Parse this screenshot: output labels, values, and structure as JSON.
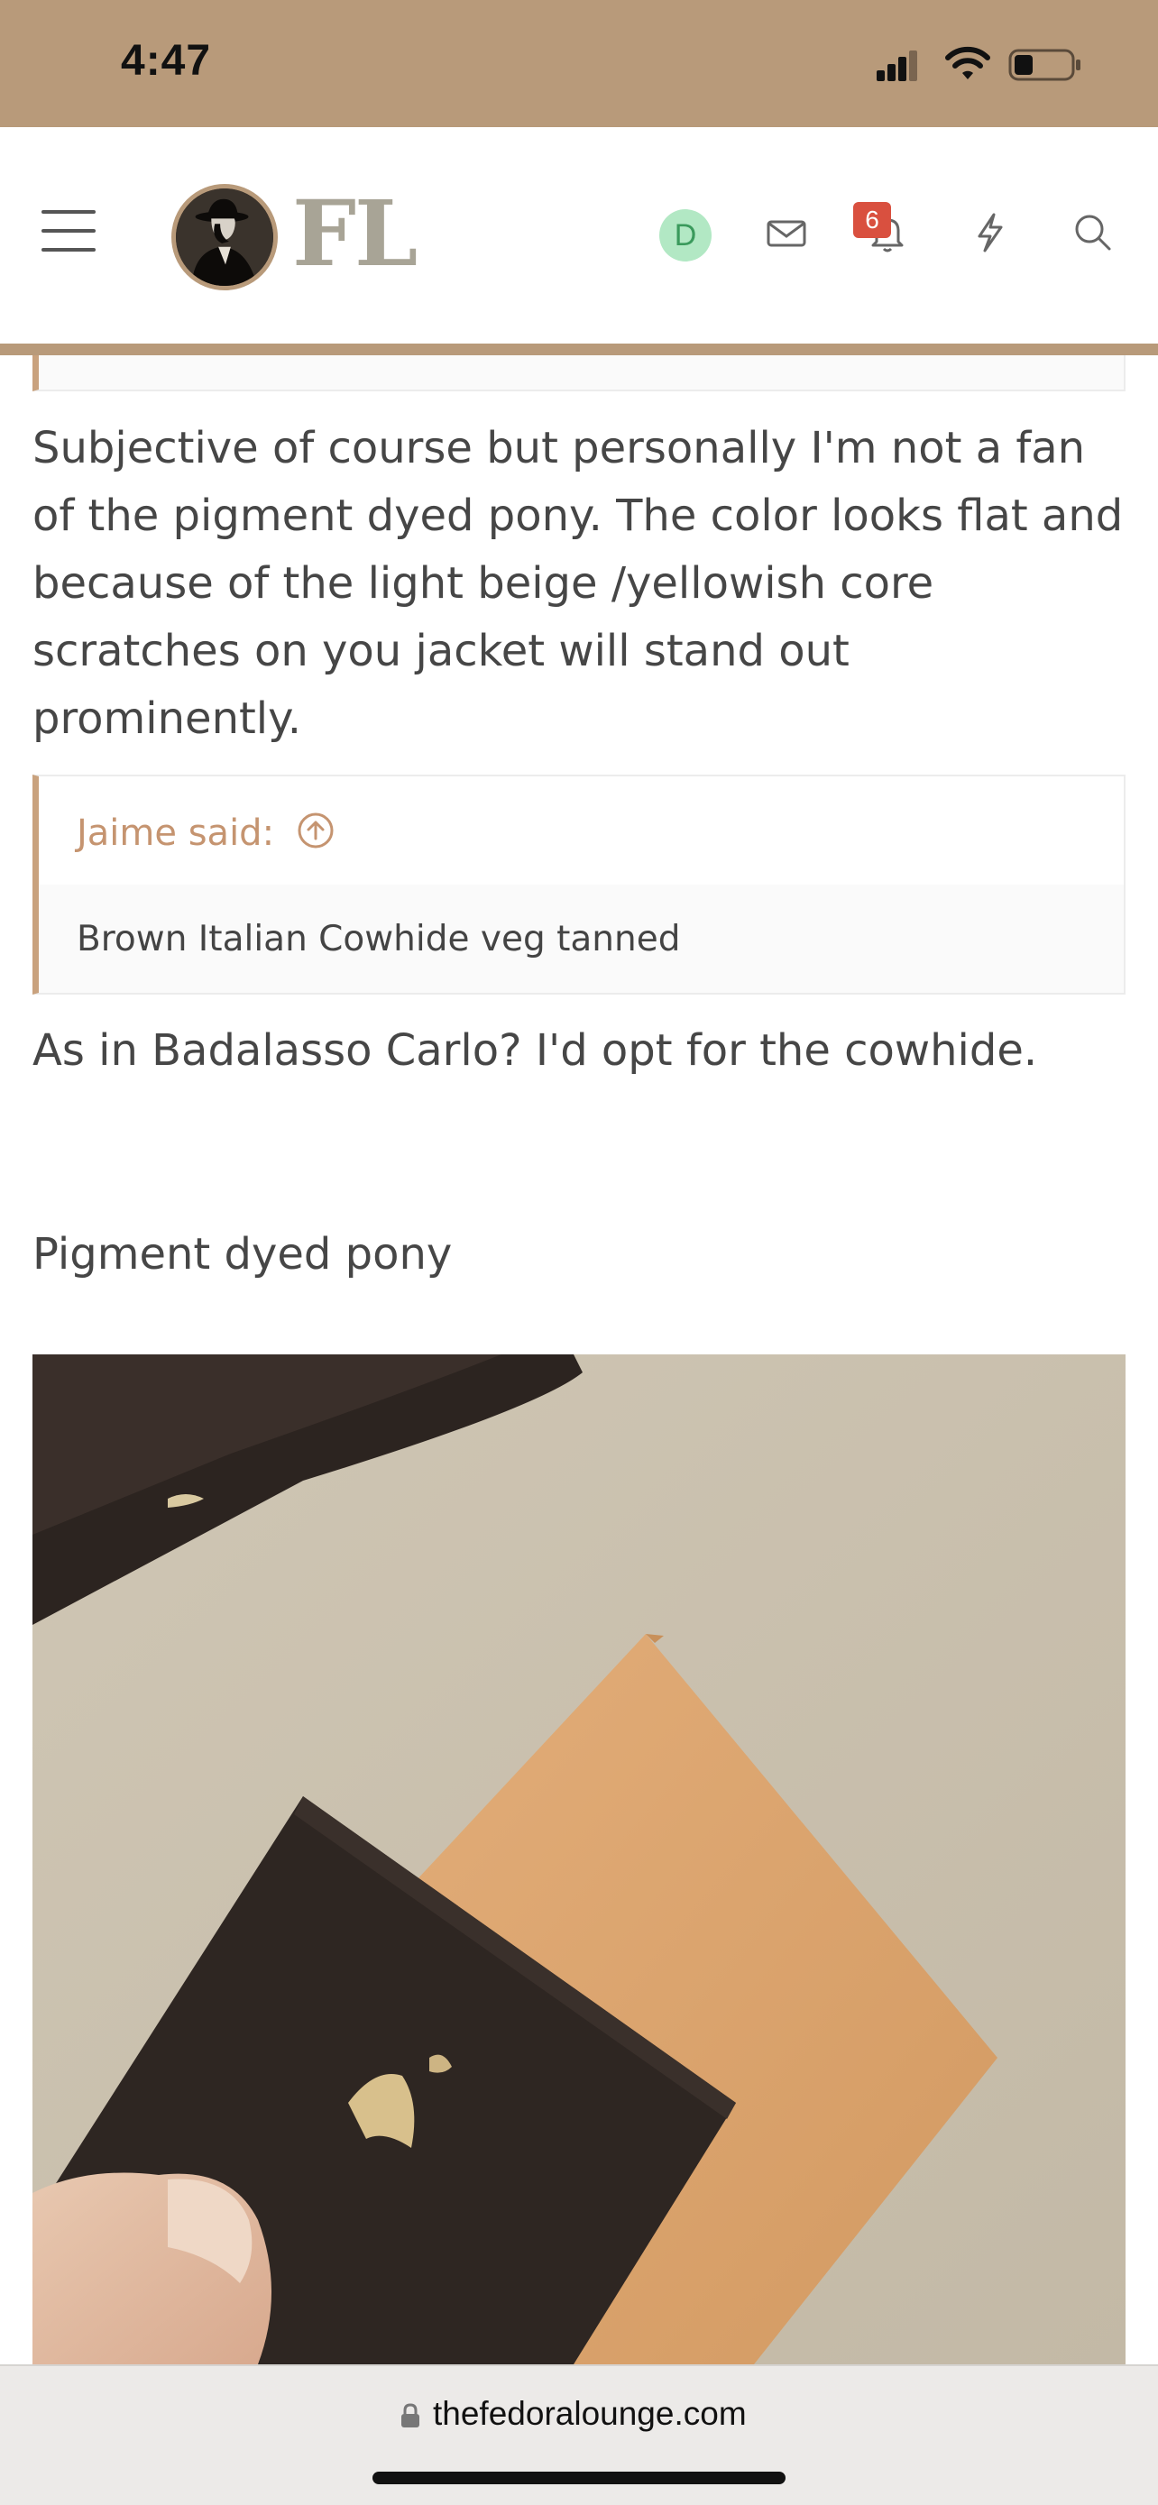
{
  "status_bar": {
    "time": "4:47"
  },
  "header": {
    "logo_text": "FL",
    "avatar_initial": "D",
    "notification_count": "6",
    "icons": [
      "menu-icon",
      "mail-icon",
      "bell-icon",
      "lightning-icon",
      "search-icon"
    ],
    "accent_color": "#b89a7a"
  },
  "post": {
    "paragraph_1": "Subjective of course but personally I'm not a fan of the pigment dyed pony. The color looks flat and because of the light beige /yellowish core scratches on you jacket will stand out prominently.",
    "quote": {
      "attribution": "Jaime said:",
      "text": "Brown Italian Cowhide veg tanned"
    },
    "paragraph_2": "As in Badalasso Carlo? I'd opt for the cowhide.",
    "paragraph_3": "Pigment dyed pony"
  },
  "browser": {
    "url": "thefedoralounge.com"
  }
}
